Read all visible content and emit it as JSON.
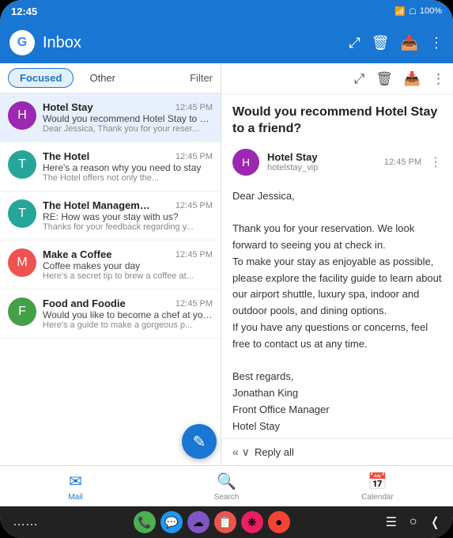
{
  "statusBar": {
    "time": "12:45",
    "wifi": "WiFi",
    "signal": "Signal",
    "battery": "100%"
  },
  "header": {
    "logo": "G",
    "title": "Inbox",
    "icons": [
      "expand",
      "delete",
      "archive",
      "more"
    ]
  },
  "tabs": {
    "focused": "Focused",
    "other": "Other",
    "filter": "Filter"
  },
  "emails": [
    {
      "sender": "Hotel Stay",
      "initial": "H",
      "color": "#9c27b0",
      "time": "12:45 PM",
      "subject": "Would you recommend Hotel Stay to a fr...",
      "preview": "Dear Jessica, Thank you for your reser...",
      "active": true
    },
    {
      "sender": "The Hotel",
      "initial": "T",
      "color": "#26a69a",
      "time": "12:45 PM",
      "subject": "Here's a reason why you need to stay",
      "preview": "The Hotel offers not only the...",
      "active": false
    },
    {
      "sender": "The Hotel Management",
      "initial": "T",
      "color": "#26a69a",
      "time": "12:45 PM",
      "subject": "RE: How was your stay with us?",
      "preview": "Thanks for your feedback regarding y...",
      "active": false
    },
    {
      "sender": "Make a Coffee",
      "initial": "M",
      "color": "#ef5350",
      "time": "12:45 PM",
      "subject": "Coffee makes your day",
      "preview": "Here's a secret tip to brew a coffee at...",
      "active": false
    },
    {
      "sender": "Food and Foodie",
      "initial": "F",
      "color": "#43a047",
      "time": "12:45 PM",
      "subject": "Would you like to become a chef at you..",
      "preview": "Here's a guide to make a gorgeous p...",
      "active": false
    }
  ],
  "detail": {
    "subject": "Would you recommend Hotel Stay to a friend?",
    "senderName": "Hotel Stay",
    "senderEmail": "hotelstay_vip",
    "senderInitial": "H",
    "senderColor": "#9c27b0",
    "time": "12:45 PM",
    "body": "Dear Jessica,\n\nThank you for your reservation. We look forward to seeing you at check in.\nTo make your stay as enjoyable as possible, please explore the facility guide to learn about our airport shuttle, luxury spa, indoor and outdoor pools, and dining options.\nIf you have any questions or concerns, feel free to contact us at any time.\n\nBest regards,\nJonathan King\nFront Office Manager\nHotel Stay",
    "replyLabel": "Reply all"
  },
  "bottomNav": {
    "items": [
      {
        "label": "Mail",
        "icon": "✉",
        "active": true
      },
      {
        "label": "Search",
        "icon": "🔍",
        "active": false
      },
      {
        "label": "Calendar",
        "icon": "📅",
        "active": false
      }
    ]
  },
  "dock": {
    "apps": [
      {
        "icon": "📞",
        "color": "#4caf50",
        "name": "phone"
      },
      {
        "icon": "💬",
        "color": "#2196f3",
        "name": "messages"
      },
      {
        "icon": "☁",
        "color": "#7e57c2",
        "name": "cloud"
      },
      {
        "icon": "📋",
        "color": "#ef5350",
        "name": "tasks"
      },
      {
        "icon": "❋",
        "color": "#e91e63",
        "name": "flower"
      },
      {
        "icon": "⏺",
        "color": "#f44336",
        "name": "record"
      }
    ]
  }
}
